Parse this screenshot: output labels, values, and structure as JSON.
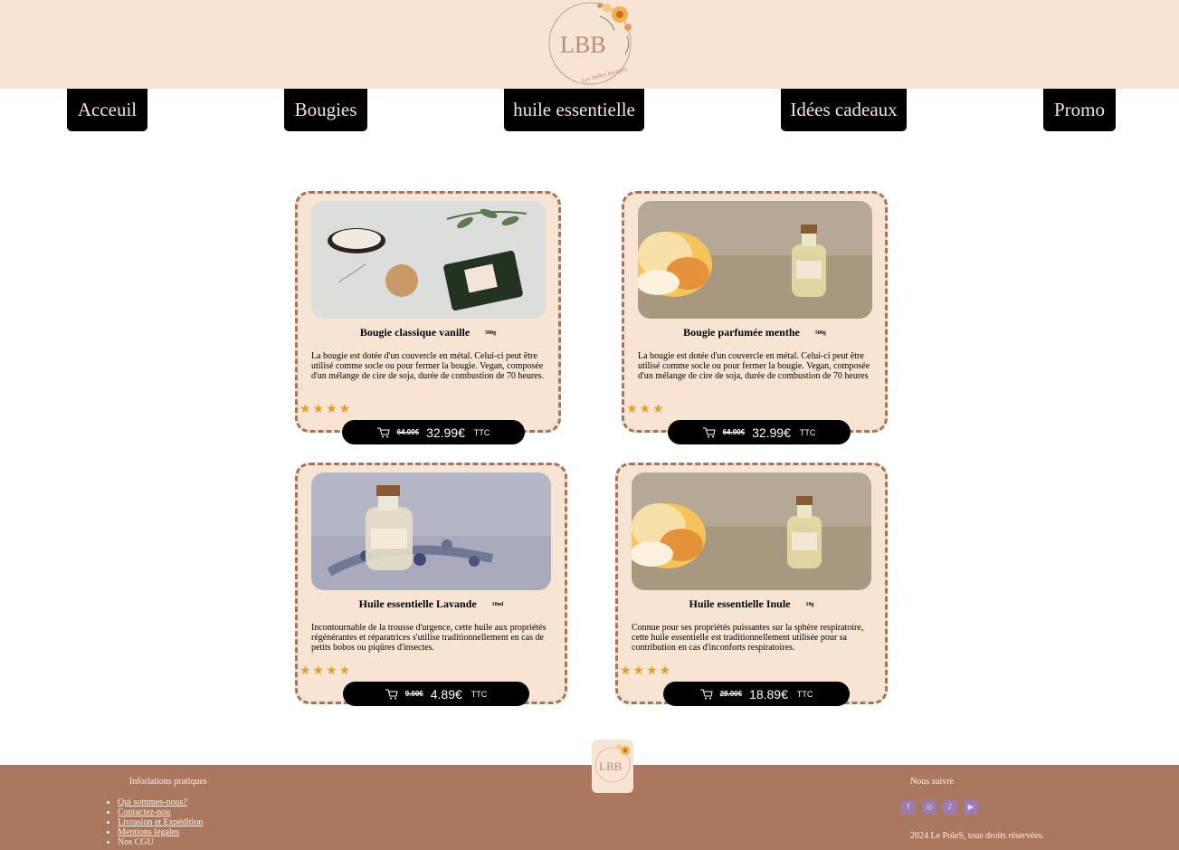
{
  "brand": {
    "logo_text": "LBB",
    "logo_subtext": "Les belles bougies"
  },
  "nav": [
    {
      "label": "Acceuil"
    },
    {
      "label": "Bougies"
    },
    {
      "label": "huile essentielle"
    },
    {
      "label": "Idées cadeaux"
    },
    {
      "label": "Promo"
    }
  ],
  "products": [
    {
      "title": "Bougie classique vanille",
      "weight": "500g",
      "description": "La bougie est dotée d'un couvercle en métal. Celui-ci peut être utilisé comme socle ou pour fermer la bougie. Vegan, composée d'un mélange de cire de soja, durée de combustion de 70 heures.",
      "rating": 4,
      "stars": "★★★★",
      "old_price": "64.00€",
      "price": "32.99€",
      "tax": "TTC",
      "image": "candle-set-photo"
    },
    {
      "title": "Bougie parfumée menthe",
      "weight": "500g",
      "description": "La bougie est dotée d'un couvercle en métal. Celui-ci peut être utilisé comme socle ou pour fermer la bougie. Vegan, composée d'un mélange de cire de soja, durée de combustion de 70 heures",
      "rating": 3,
      "stars": "★★★",
      "old_price": "64.00€",
      "price": "32.99€",
      "tax": "TTC",
      "image": "flower-oil-bottle-photo"
    },
    {
      "title": "Huile essentielle Lavande",
      "weight": "10ml",
      "description": "Incontournable de la trousse d'urgence, cette huile aux propriétés régénérantes et réparatrices s'utilise traditionnellement en cas de petits bobos ou piqûres d'insectes.",
      "rating": 4,
      "stars": "★★★★",
      "old_price": "9.00€",
      "price": "4.89€",
      "tax": "TTC",
      "image": "lavender-oil-bottle-photo"
    },
    {
      "title": "Huile essentielle Inule",
      "weight": "10g",
      "description": "Connue pour ses propriétés puissantes sur la sphère respiratoire, cette huile essentielle est traditionnellement utilisée pour sa contribution en cas d'inconforts  respiratoires.",
      "rating": 4,
      "stars": "★★★★",
      "old_price": "28.00€",
      "price": "18.89€",
      "tax": "TTC",
      "image": "flower-oil-bottle-photo"
    }
  ],
  "footer": {
    "info_title": "Inforlations pratiques",
    "links": [
      {
        "label": "Qui sommes-nous?"
      },
      {
        "label": "Contactez-nou"
      },
      {
        "label": "Livrasion et Expédition"
      },
      {
        "label": "Mentions légales"
      },
      {
        "label": "Nos CGU"
      }
    ],
    "follow_title": "Nous suivre",
    "socials": [
      {
        "icon": "facebook-icon",
        "glyph": "f"
      },
      {
        "icon": "instagram-icon",
        "glyph": "◎"
      },
      {
        "icon": "tiktok-icon",
        "glyph": "♪"
      },
      {
        "icon": "youtube-icon",
        "glyph": "▶"
      }
    ],
    "copyright": "2024 Le PoleS, tous droits réservées."
  },
  "colors": {
    "header_bg": "#f8e4d2",
    "nav_bg": "#000000",
    "card_bg": "#f8e4d2",
    "card_border": "#a8735a",
    "star": "#e0a12b",
    "footer_bg": "#aa785e"
  }
}
